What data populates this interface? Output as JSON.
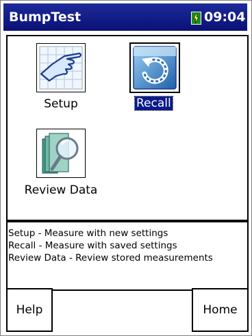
{
  "titlebar": {
    "app_name": "BumpTest",
    "time": "09:04",
    "battery_icon": "battery-charging-icon",
    "accent_color": "#0a1174"
  },
  "apps": [
    {
      "label": "Setup",
      "icon": "pointing-hand-grid-icon",
      "selected": false
    },
    {
      "label": "Recall",
      "icon": "recall-arrow-icon",
      "selected": true
    },
    {
      "label": "Review Data",
      "icon": "magnifier-book-icon",
      "selected": false
    }
  ],
  "description": {
    "lines": [
      "Setup - Measure with new settings",
      "Recall - Measure with saved settings",
      "Review Data - Review stored measurements"
    ]
  },
  "softkeys": {
    "left": "Help",
    "right": "Home"
  }
}
